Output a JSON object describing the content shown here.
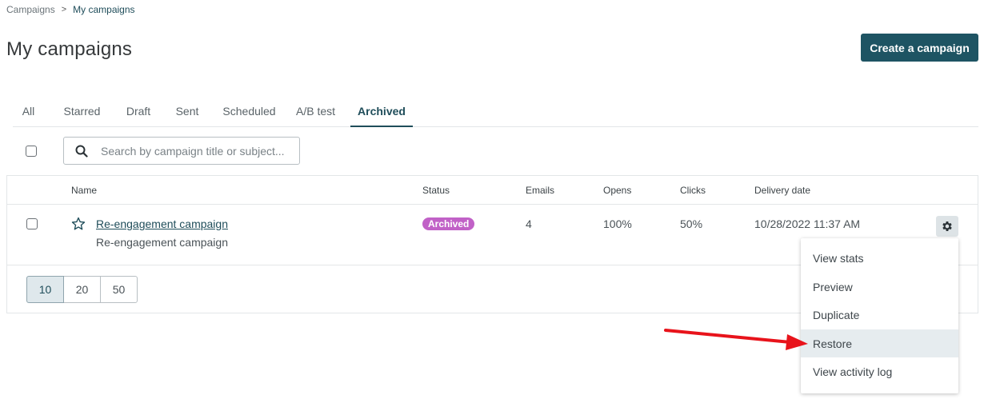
{
  "breadcrumb": {
    "root": "Campaigns",
    "separator": ">",
    "current": "My campaigns"
  },
  "page": {
    "title": "My campaigns",
    "create_label": "Create a campaign"
  },
  "tabs": [
    {
      "label": "All",
      "active": false
    },
    {
      "label": "Starred",
      "active": false
    },
    {
      "label": "Draft",
      "active": false
    },
    {
      "label": "Sent",
      "active": false
    },
    {
      "label": "Scheduled",
      "active": false
    },
    {
      "label": "A/B test",
      "active": false
    },
    {
      "label": "Archived",
      "active": true
    }
  ],
  "search": {
    "placeholder": "Search by campaign title or subject...",
    "value": ""
  },
  "table": {
    "columns": [
      "Name",
      "Status",
      "Emails",
      "Opens",
      "Clicks",
      "Delivery date"
    ],
    "rows": [
      {
        "title": "Re-engagement campaign",
        "subject": "Re-engagement campaign",
        "status": "Archived",
        "emails": "4",
        "opens": "100%",
        "clicks": "50%",
        "delivery_date": "10/28/2022 11:37 AM"
      }
    ]
  },
  "pagination": {
    "options": [
      "10",
      "20",
      "50"
    ],
    "selected": "10"
  },
  "context_menu": {
    "items": [
      "View stats",
      "Preview",
      "Duplicate",
      "Restore",
      "View activity log"
    ],
    "highlighted": "Restore"
  },
  "colors": {
    "primary": "#1e5463",
    "archived_badge": "#c161c7",
    "annotation_arrow": "#e8131b"
  },
  "icons": [
    "search-icon",
    "star-icon",
    "gear-icon",
    "arrow-annotation"
  ]
}
